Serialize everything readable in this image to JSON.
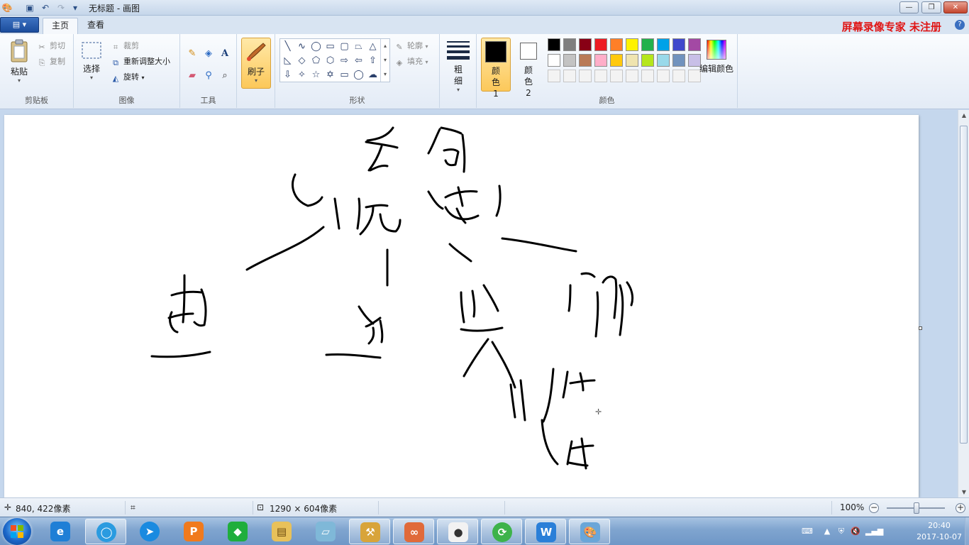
{
  "window": {
    "title": "无标题 - 画图",
    "minimize": "—",
    "maximize": "❐",
    "close": "✕"
  },
  "tabs": {
    "file_label": "▤ ▾",
    "items": [
      "主页",
      "查看"
    ]
  },
  "watermark": "屏幕录像专家  未注册",
  "ribbon": {
    "clipboard": {
      "label": "剪贴板",
      "paste": "粘贴",
      "cut": "剪切",
      "copy": "复制"
    },
    "image": {
      "label": "图像",
      "select": "选择",
      "crop": "裁剪",
      "resize": "重新调整大小",
      "rotate": "旋转"
    },
    "tools": {
      "label": "工具"
    },
    "brushes": {
      "label": "刷子"
    },
    "shapes": {
      "label": "形状",
      "outline": "轮廓",
      "fill": "填充"
    },
    "size": {
      "label": "粗细"
    },
    "colors": {
      "label": "颜色",
      "color1": "颜色 1",
      "color2": "颜色 2",
      "edit": "编辑颜色",
      "color1_value": "#000000",
      "color2_value": "#ffffff",
      "row1": [
        "#000000",
        "#7f7f7f",
        "#880015",
        "#ed1c24",
        "#ff7f27",
        "#fff200",
        "#22b14c",
        "#00a2e8",
        "#3f48cc",
        "#a349a4"
      ],
      "row2": [
        "#ffffff",
        "#c3c3c3",
        "#b97a57",
        "#ffaec9",
        "#ffc90e",
        "#efe4b0",
        "#b5e61d",
        "#99d9ea",
        "#7092be",
        "#c8bfe7"
      ]
    }
  },
  "status": {
    "cursor_pos": "840, 422像素",
    "canvas_size": "1290 × 604像素",
    "zoom": "100%"
  },
  "taskbar": {
    "apps": [
      "ie-icon",
      "qq-browser-icon",
      "feiq-icon",
      "presentation-icon",
      "green-app-icon",
      "explorer-folder-icon",
      "notepad-icon",
      "tools-icon",
      "network-app-icon",
      "media-icon",
      "sync-icon",
      "wps-icon",
      "paint-icon"
    ],
    "clock_time": "20:40",
    "clock_date": "2017-10-07"
  }
}
